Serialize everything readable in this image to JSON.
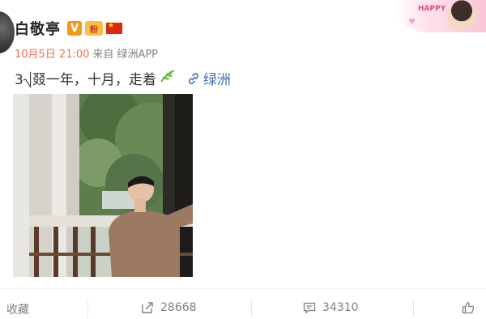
{
  "post": {
    "username": "白敬亭",
    "badge_v": "V",
    "badge_fan": "粉",
    "date": "10月5日 21:00",
    "from": "来自",
    "source": "绿洲APP",
    "text": "3⎷叕一年，十月，走着",
    "link_label": "绿洲"
  },
  "promo": {
    "text": "HAPPY"
  },
  "actions": {
    "favorite": "收藏",
    "repost": "28668",
    "comment": "34310",
    "like": ""
  },
  "colors": {
    "date": "#eb7350",
    "link": "#3b6fb6",
    "badge_v": "#f29b1a"
  }
}
